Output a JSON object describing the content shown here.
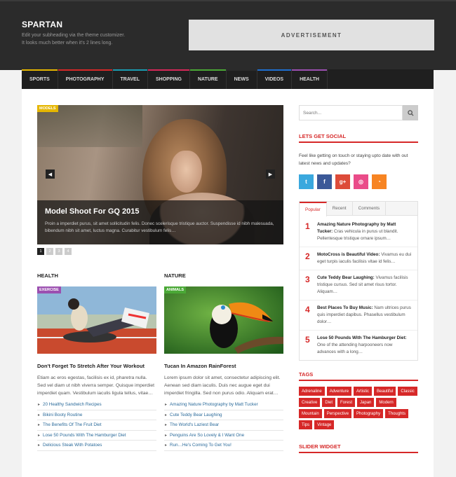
{
  "site": {
    "title": "SPARTAN",
    "subheading_line1": "Edit your subheading via the theme customizer.",
    "subheading_line2": "It looks much better when it's 2 lines long.",
    "ad_label": "ADVERTISEMENT"
  },
  "nav": {
    "items": [
      {
        "label": "SPORTS",
        "color": "#e5b600"
      },
      {
        "label": "PHOTOGRAPHY",
        "color": "#d62828"
      },
      {
        "label": "TRAVEL",
        "color": "#1a9bb0"
      },
      {
        "label": "SHOPPING",
        "color": "#d62858"
      },
      {
        "label": "NATURE",
        "color": "#4aa836"
      },
      {
        "label": "NEWS",
        "color": "#2b2b2b"
      },
      {
        "label": "VIDEOS",
        "color": "#1f6fd0"
      },
      {
        "label": "HEALTH",
        "color": "#9b4fb0"
      }
    ]
  },
  "slider": {
    "category": "MODELS",
    "title": "Model Shoot For GQ 2015",
    "excerpt": "Proin a imperdiet purus, sit amet sollicitudin felis. Donec scelerisque tristique auctor. Suspendisse id nibh malesuada, bibendum nibh sit amet, luctus magna. Curabitur vestibulum felis…",
    "prev_icon": "chevron-left-icon",
    "next_icon": "chevron-right-icon",
    "pages": [
      "1",
      "2",
      "3",
      "4"
    ]
  },
  "health": {
    "heading": "HEALTH",
    "label": "EXERCISE",
    "label_color": "#9b4fb0",
    "post_title": "Don't Forget To Stretch After Your Workout",
    "excerpt": "Etiam ac eros egestas, facilisis ex id, pharetra nulla. Sed vel diam ut nibh viverra semper. Quisque imperdiet imperdiet quam. Vestibulum iaculis ligula tellus, vitae…",
    "links": [
      "20 Healthy Sandwich Recipes",
      "Bikini Booty Routine",
      "The Benefits Of The Fruit Diet",
      "Lose 50 Pounds With The Hamburger Diet",
      "Delicious Steak With Potatoes"
    ]
  },
  "nature": {
    "heading": "NATURE",
    "label": "ANIMALS",
    "label_color": "#4aa836",
    "post_title": "Tucan In Amazon RainForest",
    "excerpt": "Lorem ipsum dolor sit amet, consectetur adipiscing elit. Aenean sed diam iaculis. Duis nec augue eget dui imperdiet fringilla. Sed non purus odio. Aliquam erat…",
    "links": [
      "Amazing Nature Photography by Matt Tucker",
      "Cute Teddy Bear Laughing",
      "The World's Laziest Bear",
      "Penguins Are So Lovely & I Want One",
      "Run…He's Coming To Get You!"
    ]
  },
  "sidebar": {
    "search_placeholder": "Search...",
    "social_title": "LETS GET SOCIAL",
    "social_text": "Feel like getting on touch or staying upto date with out latest news and updates?",
    "social_icons": [
      {
        "name": "twitter-icon",
        "glyph": "t",
        "color": "#3aa8de"
      },
      {
        "name": "facebook-icon",
        "glyph": "f",
        "color": "#3b5998"
      },
      {
        "name": "google-plus-icon",
        "glyph": "g+",
        "color": "#dd4b39"
      },
      {
        "name": "dribbble-icon",
        "glyph": "◎",
        "color": "#ea4c89"
      },
      {
        "name": "rss-icon",
        "glyph": "◔",
        "color": "#f78422"
      }
    ],
    "tabs": [
      "Popular",
      "Recent",
      "Comments"
    ],
    "popular": [
      {
        "num": "1",
        "title": "Amazing Nature Photography by Matt Tucker:",
        "text": "Cras vehicula in purus ut blandit. Pellentesque tristique ornare ipsum…"
      },
      {
        "num": "2",
        "title": "MotoCross is Beautiful Video:",
        "text": "Vivamus eu dui eget turpis iaculis facilisis vitae id felis…"
      },
      {
        "num": "3",
        "title": "Cute Teddy Bear Laughing:",
        "text": "Vivamus facilisis tristique cursus. Sed sit amet risus tortor. Aliquam…"
      },
      {
        "num": "4",
        "title": "Best Places To Buy Music:",
        "text": "Nam ultrices purus quis imperdiet dapibus. Phasellus vestibulum dolor…"
      },
      {
        "num": "5",
        "title": "Lose 50 Pounds With The Hamburger Diet:",
        "text": "One of the attending harpooneers now advances with a long…"
      }
    ],
    "tags_title": "TAGS",
    "tags": [
      "Adrenaline",
      "Adventure",
      "Artistic",
      "Beautiful",
      "Classic",
      "Creative",
      "Diet",
      "Forest",
      "Japan",
      "Modern",
      "Mountain",
      "Perspective",
      "Photography",
      "Thoughts",
      "Tips",
      "Vintage"
    ],
    "slider_widget_title": "SLIDER WIDGET"
  }
}
